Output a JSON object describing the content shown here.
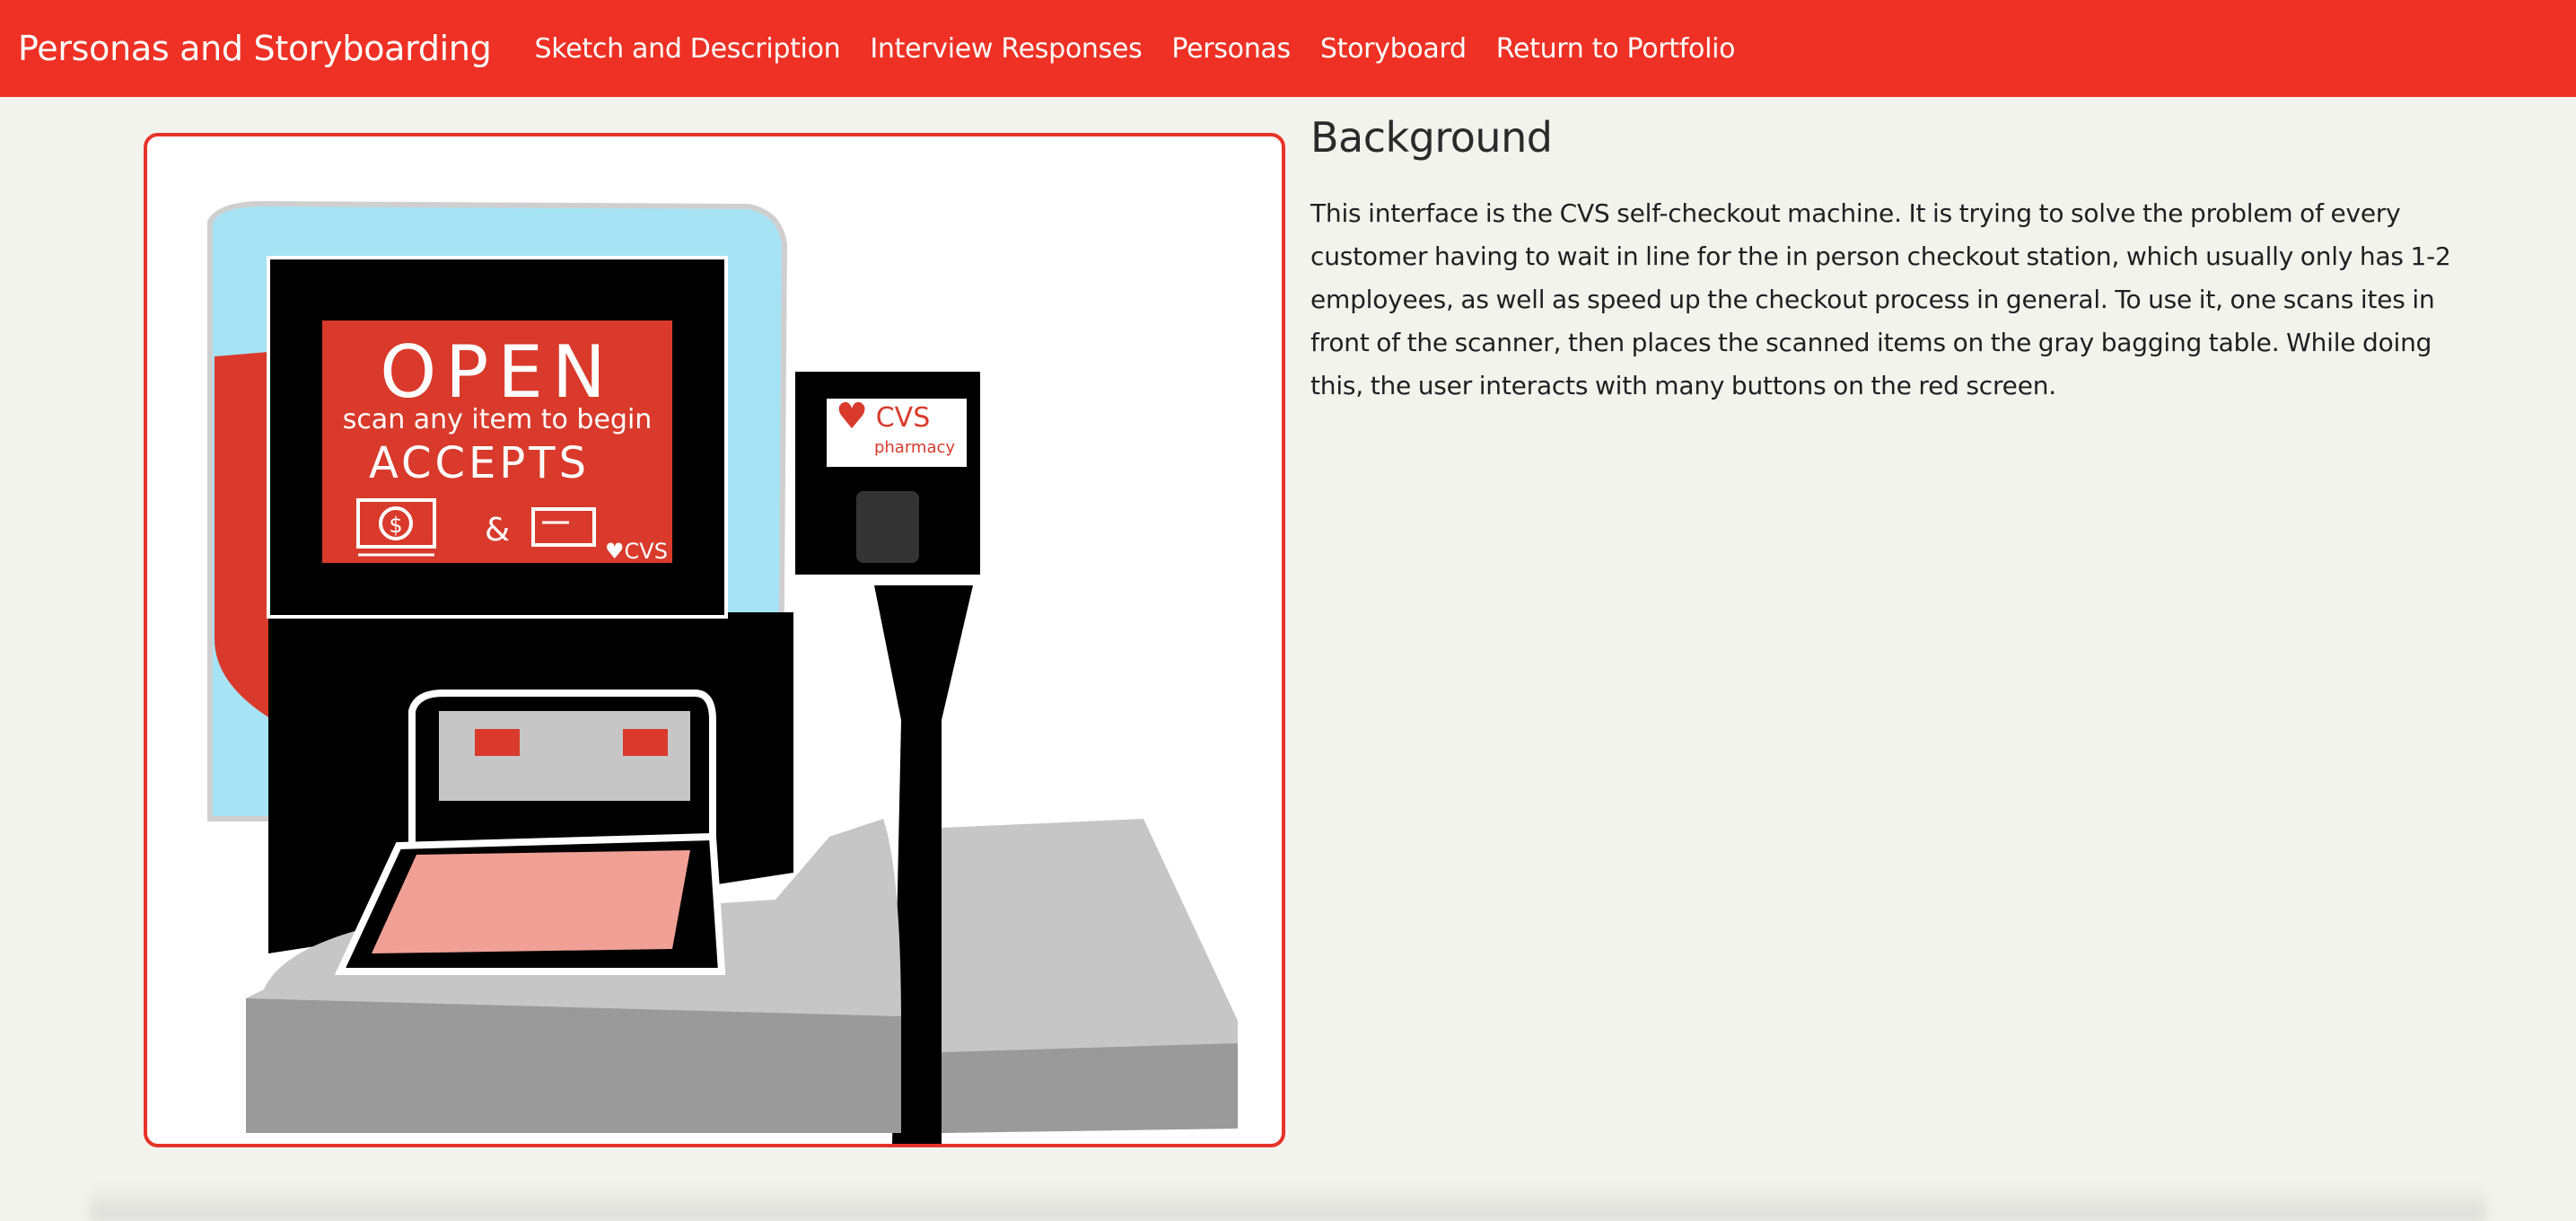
{
  "nav": {
    "brand": "Personas and Storyboarding",
    "links": [
      {
        "label": "Sketch and Description"
      },
      {
        "label": "Interview Responses"
      },
      {
        "label": "Personas"
      },
      {
        "label": "Storyboard"
      },
      {
        "label": "Return to Portfolio"
      }
    ]
  },
  "sketch": {
    "screen_line1": "OPEN",
    "screen_line2": "scan any item to begin",
    "screen_line3": "ACCEPTS",
    "screen_amp": "&",
    "screen_logo": "♥CVS",
    "pinpad_line1": "CVS",
    "pinpad_line2": "pharmacy"
  },
  "background": {
    "heading": "Background",
    "body": "This interface is the CVS self-checkout machine. It is trying to solve the problem of every customer having to wait in line for the in person checkout station, which usually only has 1-2 employees, as well as speed up the checkout process in general. To use it, one scans ites in front of the scanner, then places the scanned items on the gray bagging table. While doing this, the user interacts with many buttons on the red screen."
  },
  "colors": {
    "nav_bg": "#ee3124",
    "page_bg": "#f3f3ee",
    "frame_border": "#e63329",
    "kiosk_blue": "#a6e4f5",
    "kiosk_red": "#d93a2b"
  }
}
